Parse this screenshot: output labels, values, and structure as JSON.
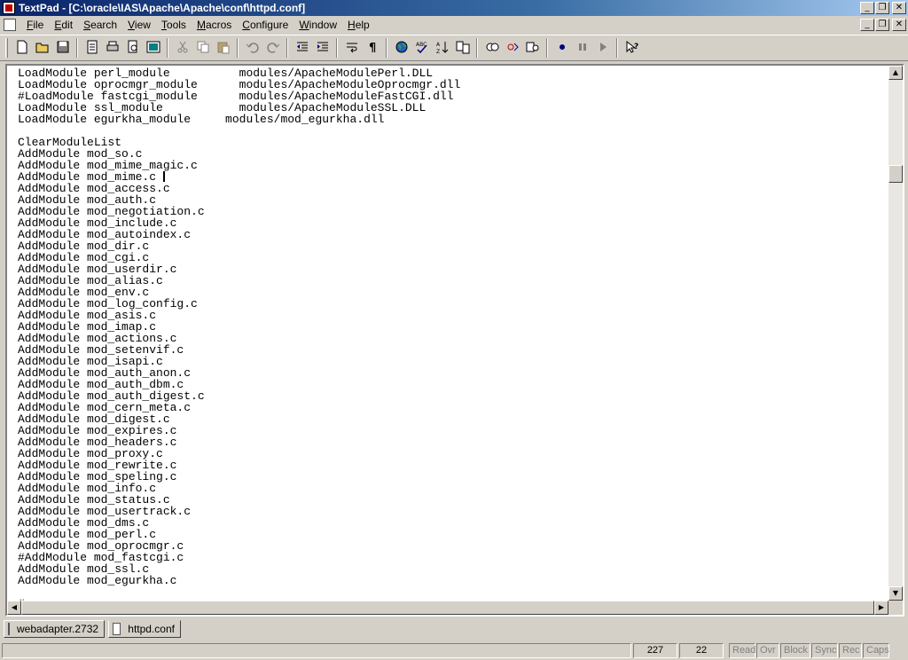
{
  "window": {
    "title": "TextPad - [C:\\oracle\\IAS\\Apache\\Apache\\conf\\httpd.conf]",
    "controls": [
      "_",
      "❐",
      "✕"
    ]
  },
  "menu": {
    "items": [
      {
        "label": "File",
        "accel": "F"
      },
      {
        "label": "Edit",
        "accel": "E"
      },
      {
        "label": "Search",
        "accel": "S"
      },
      {
        "label": "View",
        "accel": "V"
      },
      {
        "label": "Tools",
        "accel": "T"
      },
      {
        "label": "Macros",
        "accel": "M"
      },
      {
        "label": "Configure",
        "accel": "C"
      },
      {
        "label": "Window",
        "accel": "W"
      },
      {
        "label": "Help",
        "accel": "H"
      }
    ]
  },
  "toolbar": {
    "buttons": [
      "new-file-icon",
      "open-folder-icon",
      "save-icon",
      "|",
      "page-setup-icon",
      "print-icon",
      "print-preview-icon",
      "manage-files-icon",
      "|",
      "cut-icon",
      "copy-icon",
      "paste-icon",
      "|",
      "undo-icon",
      "redo-icon",
      "|",
      "indent-less-icon",
      "indent-more-icon",
      "|",
      "word-wrap-icon",
      "pilcrow-icon",
      "|",
      "web-browser-icon",
      "spell-check-icon",
      "sort-icon",
      "compare-icon",
      "|",
      "find-icon",
      "replace-icon",
      "find-in-files-icon",
      "|",
      "record-macro-icon",
      "pause-macro-icon",
      "play-macro-icon",
      "|",
      "context-help-icon"
    ]
  },
  "editor": {
    "lines": [
      "LoadModule perl_module          modules/ApacheModulePerl.DLL",
      "LoadModule oprocmgr_module      modules/ApacheModuleOprocmgr.dll",
      "#LoadModule fastcgi_module      modules/ApacheModuleFastCGI.dll",
      "LoadModule ssl_module           modules/ApacheModuleSSL.DLL",
      "LoadModule egurkha_module     modules/mod_egurkha.dll",
      "",
      "ClearModuleList",
      "AddModule mod_so.c",
      "AddModule mod_mime_magic.c",
      "AddModule mod_mime.c ",
      "AddModule mod_access.c",
      "AddModule mod_auth.c",
      "AddModule mod_negotiation.c",
      "AddModule mod_include.c",
      "AddModule mod_autoindex.c",
      "AddModule mod_dir.c",
      "AddModule mod_cgi.c",
      "AddModule mod_userdir.c",
      "AddModule mod_alias.c",
      "AddModule mod_env.c",
      "AddModule mod_log_config.c",
      "AddModule mod_asis.c",
      "AddModule mod_imap.c",
      "AddModule mod_actions.c",
      "AddModule mod_setenvif.c",
      "AddModule mod_isapi.c",
      "AddModule mod_auth_anon.c",
      "AddModule mod_auth_dbm.c",
      "AddModule mod_auth_digest.c",
      "AddModule mod_cern_meta.c",
      "AddModule mod_digest.c",
      "AddModule mod_expires.c",
      "AddModule mod_headers.c",
      "AddModule mod_proxy.c",
      "AddModule mod_rewrite.c",
      "AddModule mod_speling.c",
      "AddModule mod_info.c",
      "AddModule mod_status.c",
      "AddModule mod_usertrack.c",
      "AddModule mod_dms.c",
      "AddModule mod_perl.c",
      "AddModule mod_oprocmgr.c",
      "#AddModule mod_fastcgi.c",
      "AddModule mod_ssl.c",
      "AddModule mod_egurkha.c",
      "",
      "#"
    ],
    "caret_line": 9
  },
  "tabs": [
    {
      "label": "webadapter.2732",
      "active": false
    },
    {
      "label": "httpd.conf",
      "active": true
    }
  ],
  "status": {
    "line": "227",
    "column": "22",
    "flags": [
      "Read",
      "Ovr",
      "Block",
      "Sync",
      "Rec",
      "Caps"
    ]
  }
}
